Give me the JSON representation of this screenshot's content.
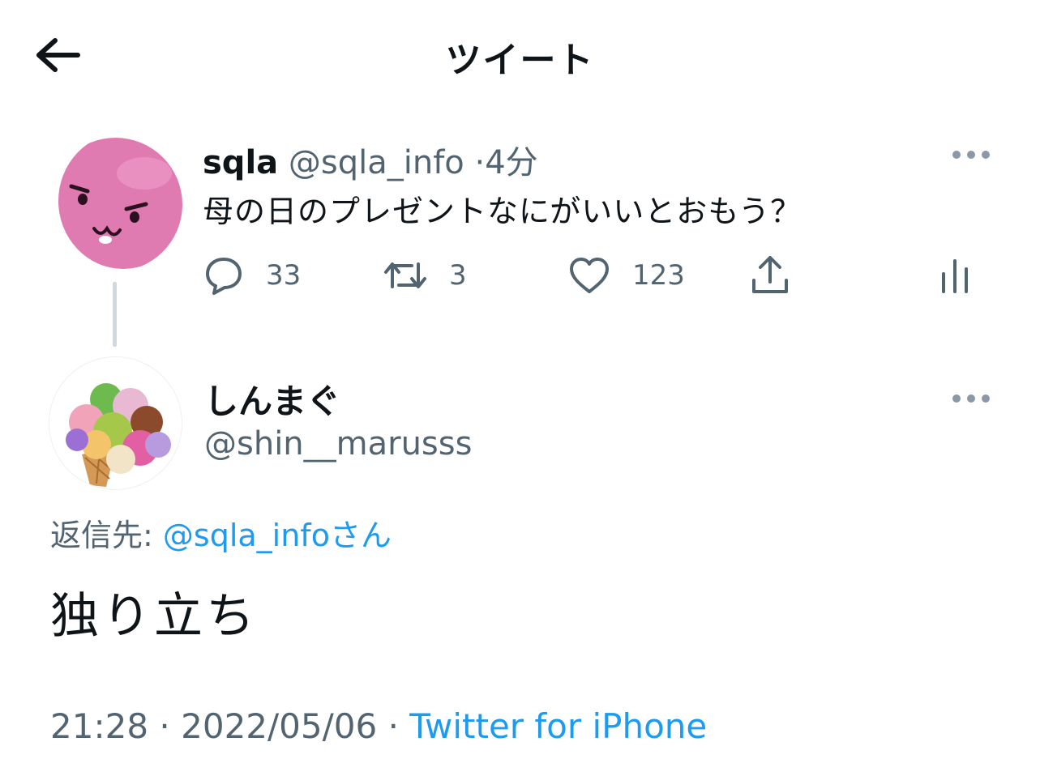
{
  "header": {
    "title": "ツイート"
  },
  "parent_tweet": {
    "name": "sqla",
    "handle": "@sqla_info",
    "sep": "·",
    "time": "4分",
    "text": "母の日のプレゼントなにがいいとおもう？",
    "replies": "33",
    "retweets": "3",
    "likes": "123"
  },
  "reply_tweet": {
    "name": "しんまぐ",
    "handle": "@shin__marusss",
    "reply_label": "返信先:",
    "reply_to": "@sqla_infoさん",
    "text": "独り立ち",
    "time": "21:28",
    "sep1": "·",
    "date": "2022/05/06",
    "sep2": "·",
    "client": "Twitter for iPhone"
  },
  "colors": {
    "link": "#1d9bf0",
    "muted": "#536471",
    "text": "#0f1419",
    "avatar_pink": "#e07bb1"
  }
}
